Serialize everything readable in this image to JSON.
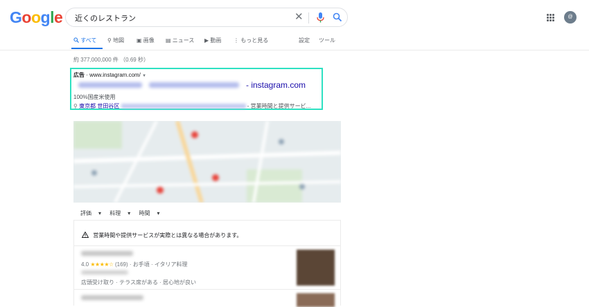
{
  "logo": {
    "letters": [
      "G",
      "o",
      "o",
      "g",
      "l",
      "e"
    ],
    "colors": [
      "#4285f4",
      "#ea4335",
      "#fbbc05",
      "#4285f4",
      "#34a853",
      "#ea4335"
    ]
  },
  "search": {
    "query": "近くのレストラン",
    "clear_icon": "close-icon",
    "mic_icon": "mic-icon",
    "search_icon": "search-icon"
  },
  "header": {
    "avatar_initials": "@"
  },
  "tabs": [
    {
      "label": "すべて",
      "icon": "search-icon",
      "active": true
    },
    {
      "label": "地図",
      "icon": "map-pin-icon"
    },
    {
      "label": "画像",
      "icon": "image-icon"
    },
    {
      "label": "ニュース",
      "icon": "news-icon"
    },
    {
      "label": "動画",
      "icon": "video-icon"
    },
    {
      "label": "もっと見る",
      "icon": "more-icon"
    },
    {
      "label": "設定"
    },
    {
      "label": "ツール"
    }
  ],
  "results_stats": "約 377,000,000 件 （0.69 秒）",
  "ad": {
    "badge": "広告",
    "url": "www.instagram.com/",
    "title_suffix": "- instagram.com",
    "description": "100%国産米使用",
    "location_prefix": "東京都 世田谷区",
    "location_suffix": "- 営業時間と提供サービ..."
  },
  "filters": [
    "評価",
    "料理",
    "時間"
  ],
  "notice": "営業時間や提供サービスが実際とは異なる場合があります。",
  "listing": {
    "rating": "4.0",
    "reviews": "(169)",
    "price_type": "· お手頃 · イタリア料理",
    "services": "店頭受け取り · テラス席がある · 居心地が良い"
  },
  "accent": {
    "link": "#1a0dab",
    "tab_active": "#1a73e8",
    "highlight_border": "#2de1c2",
    "star": "#fbbc04"
  }
}
